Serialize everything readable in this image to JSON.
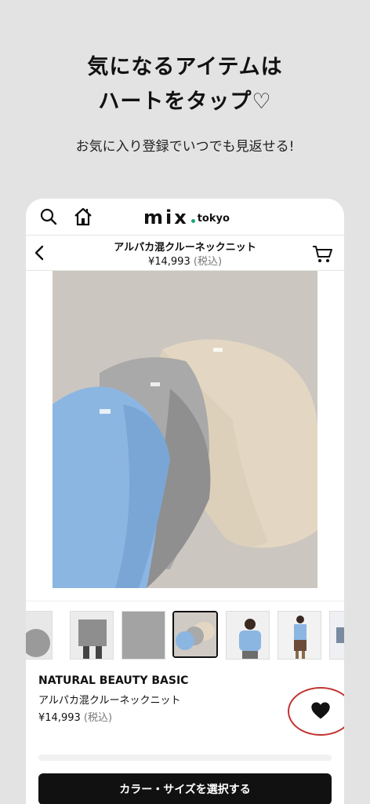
{
  "promo": {
    "headline_line1": "気になるアイテムは",
    "headline_line2": "ハートをタップ♡",
    "subtitle": "お気に入り登録でいつでも見返せる!"
  },
  "app": {
    "logo_main": "mix",
    "logo_suffix": "tokyo",
    "icons": [
      "search-icon",
      "home-icon",
      "back-icon",
      "cart-icon",
      "heart-icon"
    ]
  },
  "nav": {
    "title": "アルパカ混クルーネックニット",
    "price": "¥14,993",
    "tax": "(税込)"
  },
  "product": {
    "brand": "NATURAL BEAUTY BASIC",
    "name": "アルパカ混クルーネックニット",
    "price": "¥14,993",
    "tax": "(税込)",
    "selected_thumbnail_index": 3
  },
  "cta": {
    "label": "カラー・サイズを選択する"
  },
  "colors": {
    "accent_ring": "#c2322f",
    "logo_dot": "#1aa57a",
    "cta_bg": "#111111"
  }
}
